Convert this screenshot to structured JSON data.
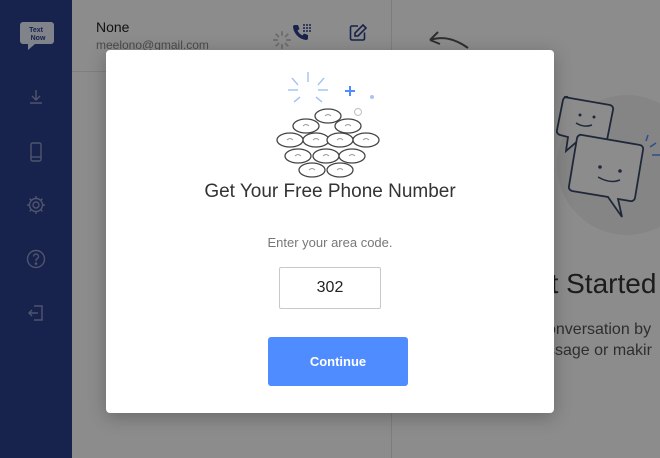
{
  "sidebar": {
    "logo_text_top": "TextNow",
    "logo_text_bottom": "Now",
    "items": [
      {
        "name": "download-icon"
      },
      {
        "name": "phone-device-icon"
      },
      {
        "name": "gear-icon"
      },
      {
        "name": "help-icon"
      },
      {
        "name": "logout-icon"
      }
    ]
  },
  "account": {
    "name": "None",
    "email": "meelono@gmail.com"
  },
  "main": {
    "title": "et Started",
    "subtitle_line1": "onversation by",
    "subtitle_line2": "ssage or makir"
  },
  "modal": {
    "title": "Get Your Free Phone Number",
    "prompt": "Enter your area code.",
    "area_code": "302",
    "continue_label": "Continue"
  },
  "colors": {
    "rail": "#2b3f8c",
    "accent": "#4f8cff"
  }
}
